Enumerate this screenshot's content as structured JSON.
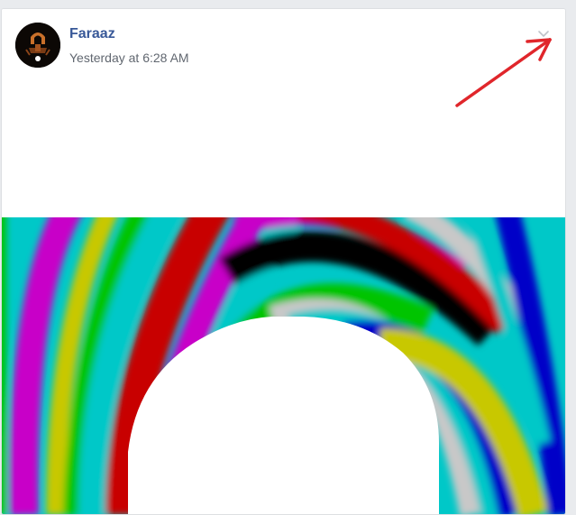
{
  "post": {
    "author": "Faraaz",
    "timestamp": "Yesterday at 6:28 AM"
  },
  "icons": {
    "avatar": "profile-picture",
    "menu": "chevron-down-icon",
    "annotation": "red-arrow-annotation"
  },
  "colors": {
    "author_link": "#385898",
    "timestamp": "#616770",
    "card_border": "#dddfe2",
    "page_bg": "#e9ebee",
    "annotation_arrow": "#e0262b"
  }
}
